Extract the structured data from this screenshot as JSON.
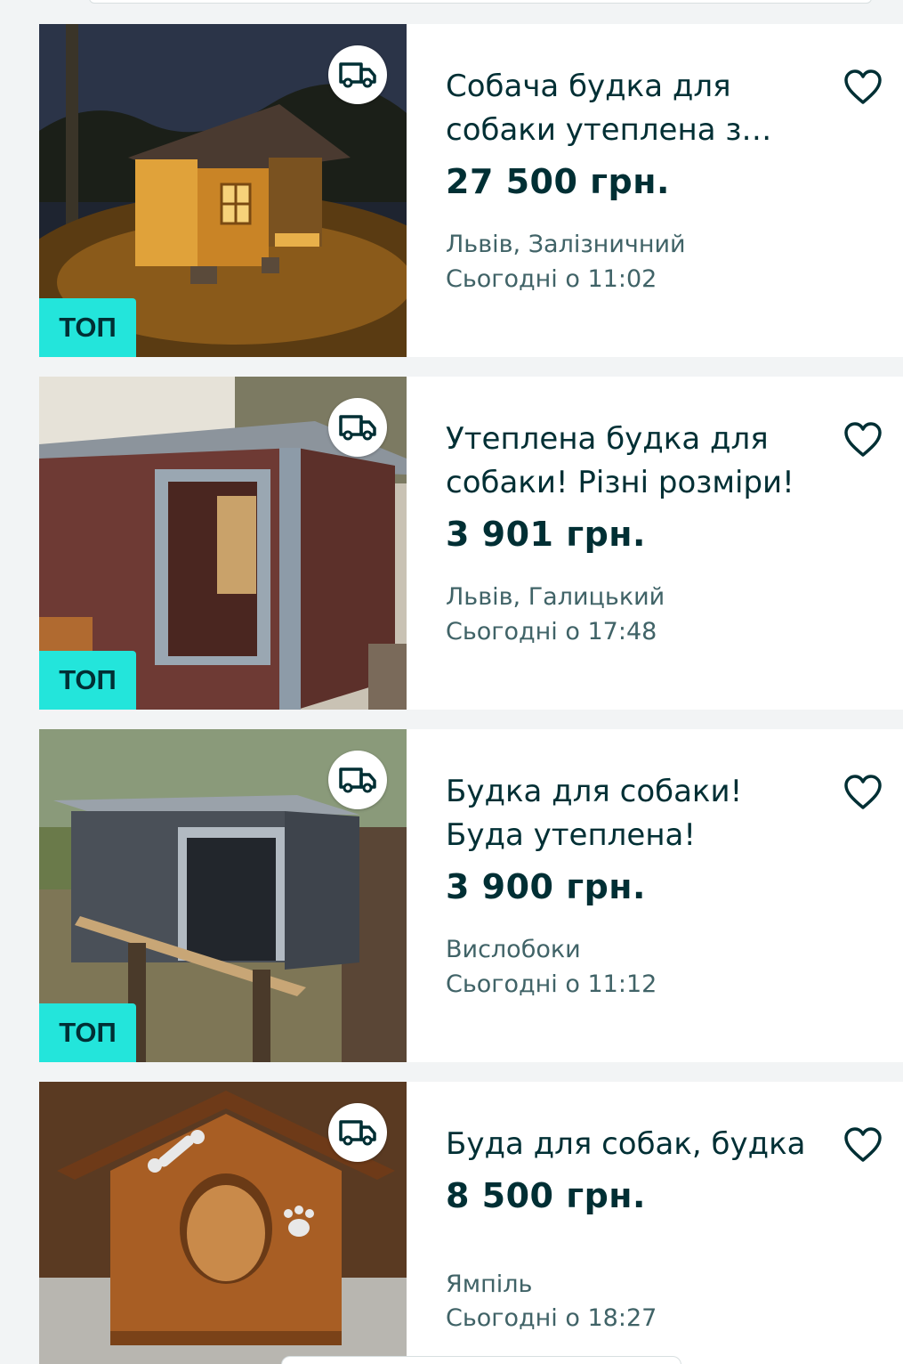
{
  "listings": [
    {
      "title": "Собача будка для собаки утеплена з…",
      "price": "27 500 грн.",
      "location": "Львів, Залізничний",
      "date": "Сьогодні о 11:02",
      "top_badge": "ТОП",
      "delivery_icon": "truck-icon",
      "favorite_icon": "heart-icon"
    },
    {
      "title": "Утеплена будка для собаки! Різні розміри!",
      "price": "3 901 грн.",
      "location": "Львів, Галицький",
      "date": "Сьогодні о 17:48",
      "top_badge": "ТОП",
      "delivery_icon": "truck-icon",
      "favorite_icon": "heart-icon"
    },
    {
      "title": "Будка для собаки! Буда утеплена!",
      "price": "3 900 грн.",
      "location": "Вислобоки",
      "date": "Сьогодні о 11:12",
      "top_badge": "ТОП",
      "delivery_icon": "truck-icon",
      "favorite_icon": "heart-icon"
    },
    {
      "title": "Буда для собак, будка",
      "price": "8 500 грн.",
      "location": "Ямпіль",
      "date": "Сьогодні о 18:27",
      "delivery_icon": "truck-icon",
      "favorite_icon": "heart-icon"
    }
  ],
  "colors": {
    "background": "#f2f4f5",
    "card": "#ffffff",
    "text_primary": "#002f34",
    "text_secondary": "#406367",
    "top_badge": "#23e5db"
  }
}
